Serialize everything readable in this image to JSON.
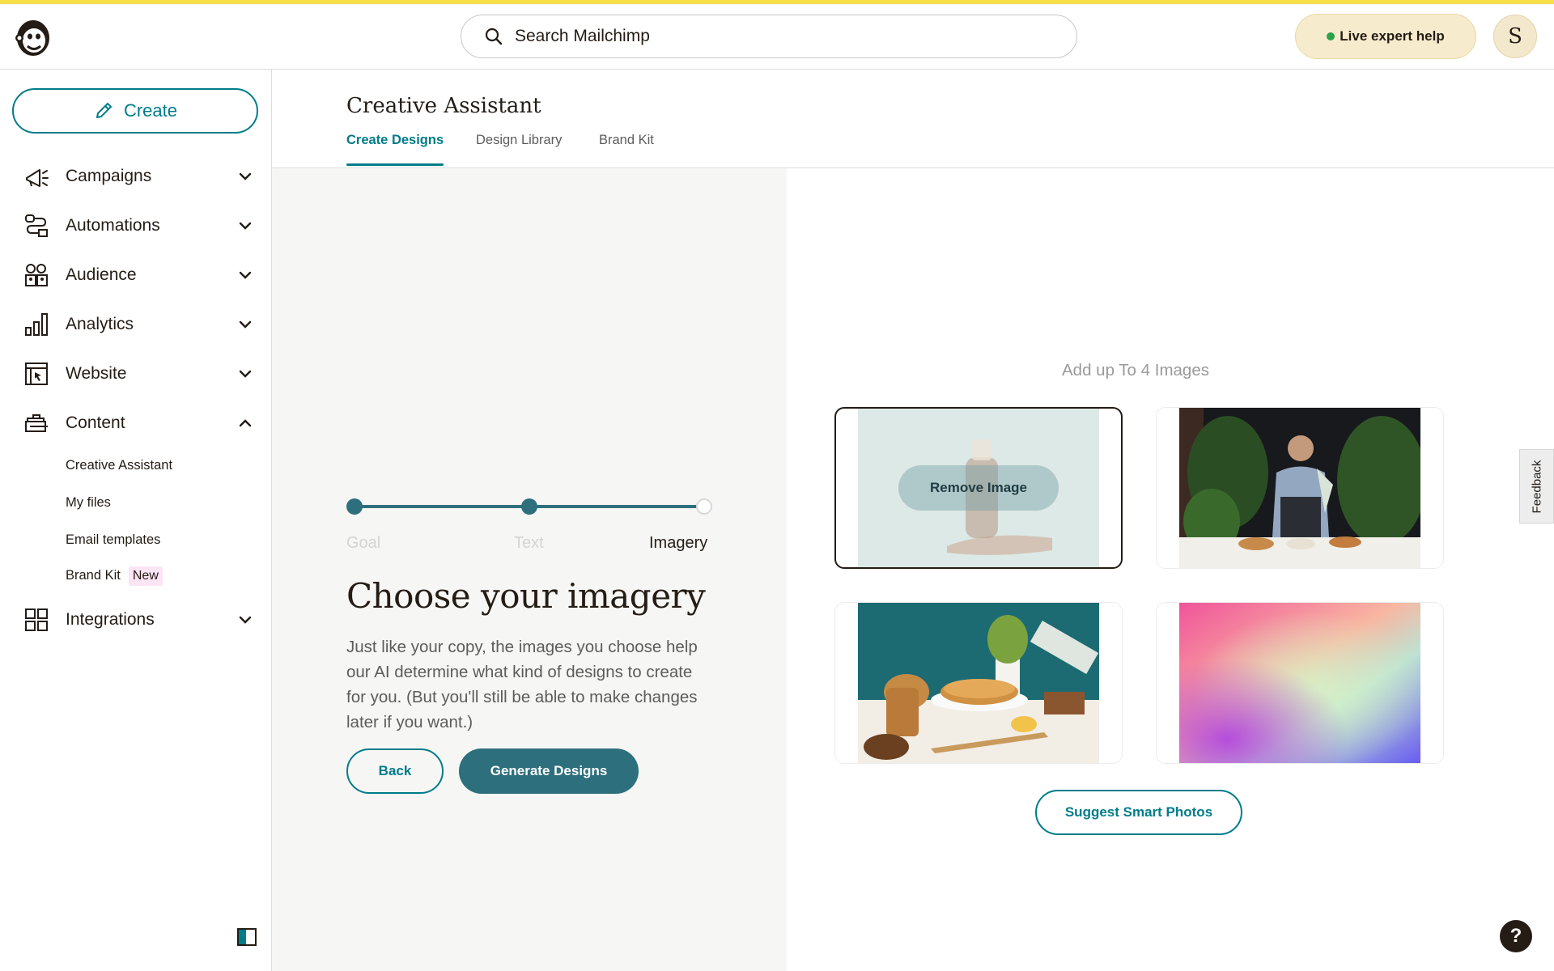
{
  "header": {
    "search_placeholder": "Search Mailchimp",
    "live_help": "Live expert help",
    "avatar_initial": "S"
  },
  "sidebar": {
    "create_label": "Create",
    "items": [
      {
        "label": "Campaigns",
        "icon": "megaphone-icon",
        "expanded": false
      },
      {
        "label": "Automations",
        "icon": "automation-icon",
        "expanded": false
      },
      {
        "label": "Audience",
        "icon": "audience-icon",
        "expanded": false
      },
      {
        "label": "Analytics",
        "icon": "bar-chart-icon",
        "expanded": false
      },
      {
        "label": "Website",
        "icon": "website-icon",
        "expanded": false
      },
      {
        "label": "Content",
        "icon": "content-icon",
        "expanded": true
      },
      {
        "label": "Integrations",
        "icon": "grid-icon",
        "expanded": false
      }
    ],
    "content_subitems": [
      "Creative Assistant",
      "My files",
      "Email templates",
      "Brand Kit"
    ],
    "new_badge": "New"
  },
  "page": {
    "title": "Creative Assistant",
    "tabs": [
      "Create Designs",
      "Design Library",
      "Brand Kit"
    ],
    "active_tab": "Create Designs"
  },
  "wizard": {
    "steps": [
      "Goal",
      "Text",
      "Imagery"
    ],
    "active_step": "Imagery",
    "heading": "Choose your imagery",
    "description": "Just like your copy, the images you choose help our AI determine what kind of designs to create for you. (But you'll still be able to make changes later if you want.)",
    "back_label": "Back",
    "generate_label": "Generate Designs"
  },
  "images": {
    "hint": "Add up To 4 Images",
    "remove_label": "Remove Image",
    "suggest_label": "Suggest Smart Photos"
  },
  "misc": {
    "feedback_label": "Feedback",
    "help_label": "?"
  },
  "colors": {
    "accent": "#007c89",
    "stepper": "#2e6f7d",
    "top_bar": "#f6df4a",
    "live_help_bg": "#f7ebcd"
  }
}
